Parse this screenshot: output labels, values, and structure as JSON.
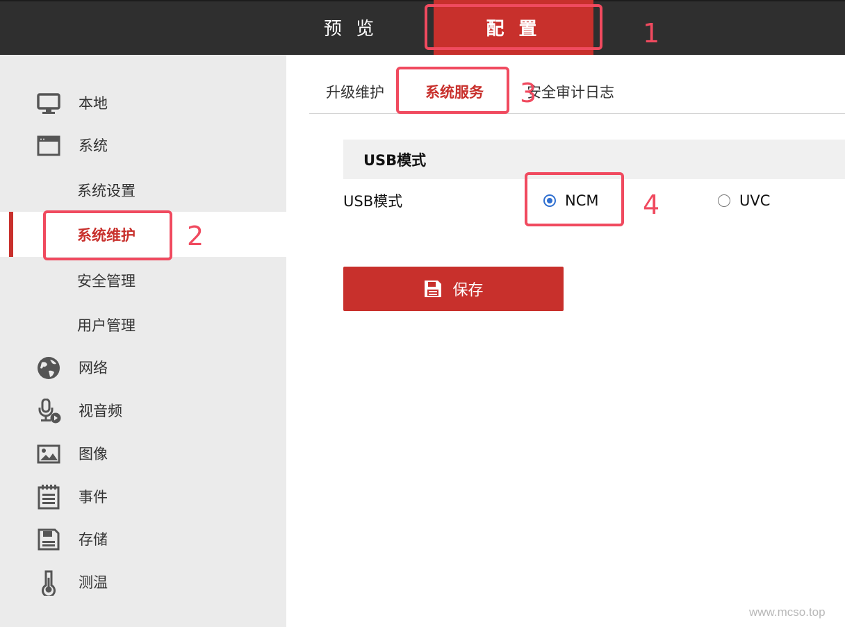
{
  "topnav": {
    "tabs": [
      {
        "label": "预 览",
        "active": false
      },
      {
        "label": "配 置",
        "active": true
      }
    ]
  },
  "sidebar": {
    "items": [
      {
        "label": "本地",
        "icon": "monitor-icon"
      },
      {
        "label": "系统",
        "icon": "window-icon"
      },
      {
        "label": "系统设置",
        "sub": true
      },
      {
        "label": "系统维护",
        "sub": true,
        "active": true
      },
      {
        "label": "安全管理",
        "sub": true
      },
      {
        "label": "用户管理",
        "sub": true
      },
      {
        "label": "网络",
        "icon": "globe-icon"
      },
      {
        "label": "视音频",
        "icon": "microphone-icon"
      },
      {
        "label": "图像",
        "icon": "image-icon"
      },
      {
        "label": "事件",
        "icon": "notepad-icon"
      },
      {
        "label": "存储",
        "icon": "floppy-icon"
      },
      {
        "label": "测温",
        "icon": "thermometer-icon"
      }
    ]
  },
  "subtabs": {
    "items": [
      {
        "label": "升级维护",
        "active": false
      },
      {
        "label": "系统服务",
        "active": true
      },
      {
        "label": "安全审计日志",
        "active": false
      }
    ]
  },
  "usb": {
    "section_title": "USB模式",
    "field_label": "USB模式",
    "options": [
      {
        "label": "NCM",
        "selected": true
      },
      {
        "label": "UVC",
        "selected": false
      }
    ]
  },
  "save_label": "保存",
  "annotations": [
    "1",
    "2",
    "3",
    "4"
  ],
  "watermark": "www.mcso.top",
  "colors": {
    "accent": "#c8302c",
    "topbar": "#2f2f2f",
    "sidebar": "#ebebeb",
    "annotation": "#f04a5f",
    "radio": "#2f6fd0"
  }
}
